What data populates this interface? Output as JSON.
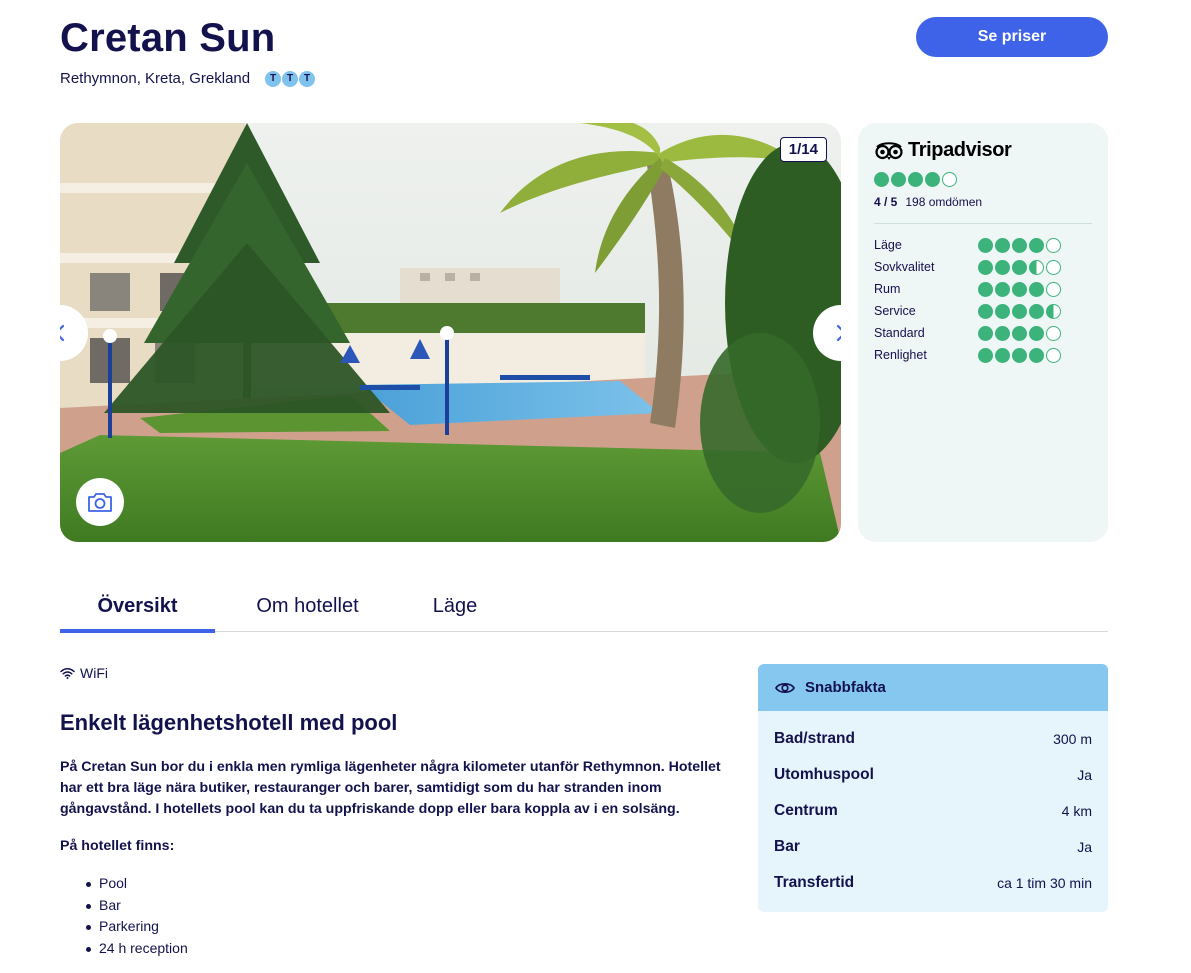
{
  "header": {
    "title": "Cretan Sun",
    "location": "Rethymnon, Kreta, Grekland",
    "rating_badges": [
      "T",
      "T",
      "T"
    ],
    "price_button": "Se priser"
  },
  "gallery": {
    "counter": "1/14",
    "prev_icon": "chevron-left-icon",
    "next_icon": "chevron-right-icon",
    "camera_icon": "camera-icon"
  },
  "tripadvisor": {
    "logo_text": "Tripadvisor",
    "overall": 4,
    "score": "4 / 5",
    "reviews": "198 omdömen",
    "categories": [
      {
        "label": "Läge",
        "rating": 4
      },
      {
        "label": "Sovkvalitet",
        "rating": 3.5
      },
      {
        "label": "Rum",
        "rating": 4
      },
      {
        "label": "Service",
        "rating": 4.5
      },
      {
        "label": "Standard",
        "rating": 4
      },
      {
        "label": "Renlighet",
        "rating": 4
      }
    ]
  },
  "tabs": [
    {
      "label": "Översikt",
      "active": true
    },
    {
      "label": "Om hotellet",
      "active": false
    },
    {
      "label": "Läge",
      "active": false
    }
  ],
  "overview": {
    "wifi": "WiFi",
    "heading": "Enkelt lägenhetshotell med pool",
    "description": "På Cretan Sun bor du i enkla men rymliga lägenheter några kilometer utanför Rethymnon. Hotellet har ett bra läge nära butiker, restauranger och barer, samtidigt som du har stranden inom gångavstånd. I hotellets pool kan du ta uppfriskande dopp eller bara koppla av i en solsäng.",
    "amenities_label": "På hotellet finns:",
    "amenities": [
      "Pool",
      "Bar",
      "Parkering",
      "24 h reception"
    ]
  },
  "quick_facts": {
    "title": "Snabbfakta",
    "rows": [
      {
        "key": "Bad/strand",
        "value": "300 m"
      },
      {
        "key": "Utomhuspool",
        "value": "Ja"
      },
      {
        "key": "Centrum",
        "value": "4 km"
      },
      {
        "key": "Bar",
        "value": "Ja"
      },
      {
        "key": "Transfertid",
        "value": "ca 1 tim 30 min"
      }
    ]
  },
  "colors": {
    "navy": "#13124d",
    "accent": "#3e63e8",
    "ta_green": "#3cb37b",
    "facts_header": "#85c7ef"
  }
}
